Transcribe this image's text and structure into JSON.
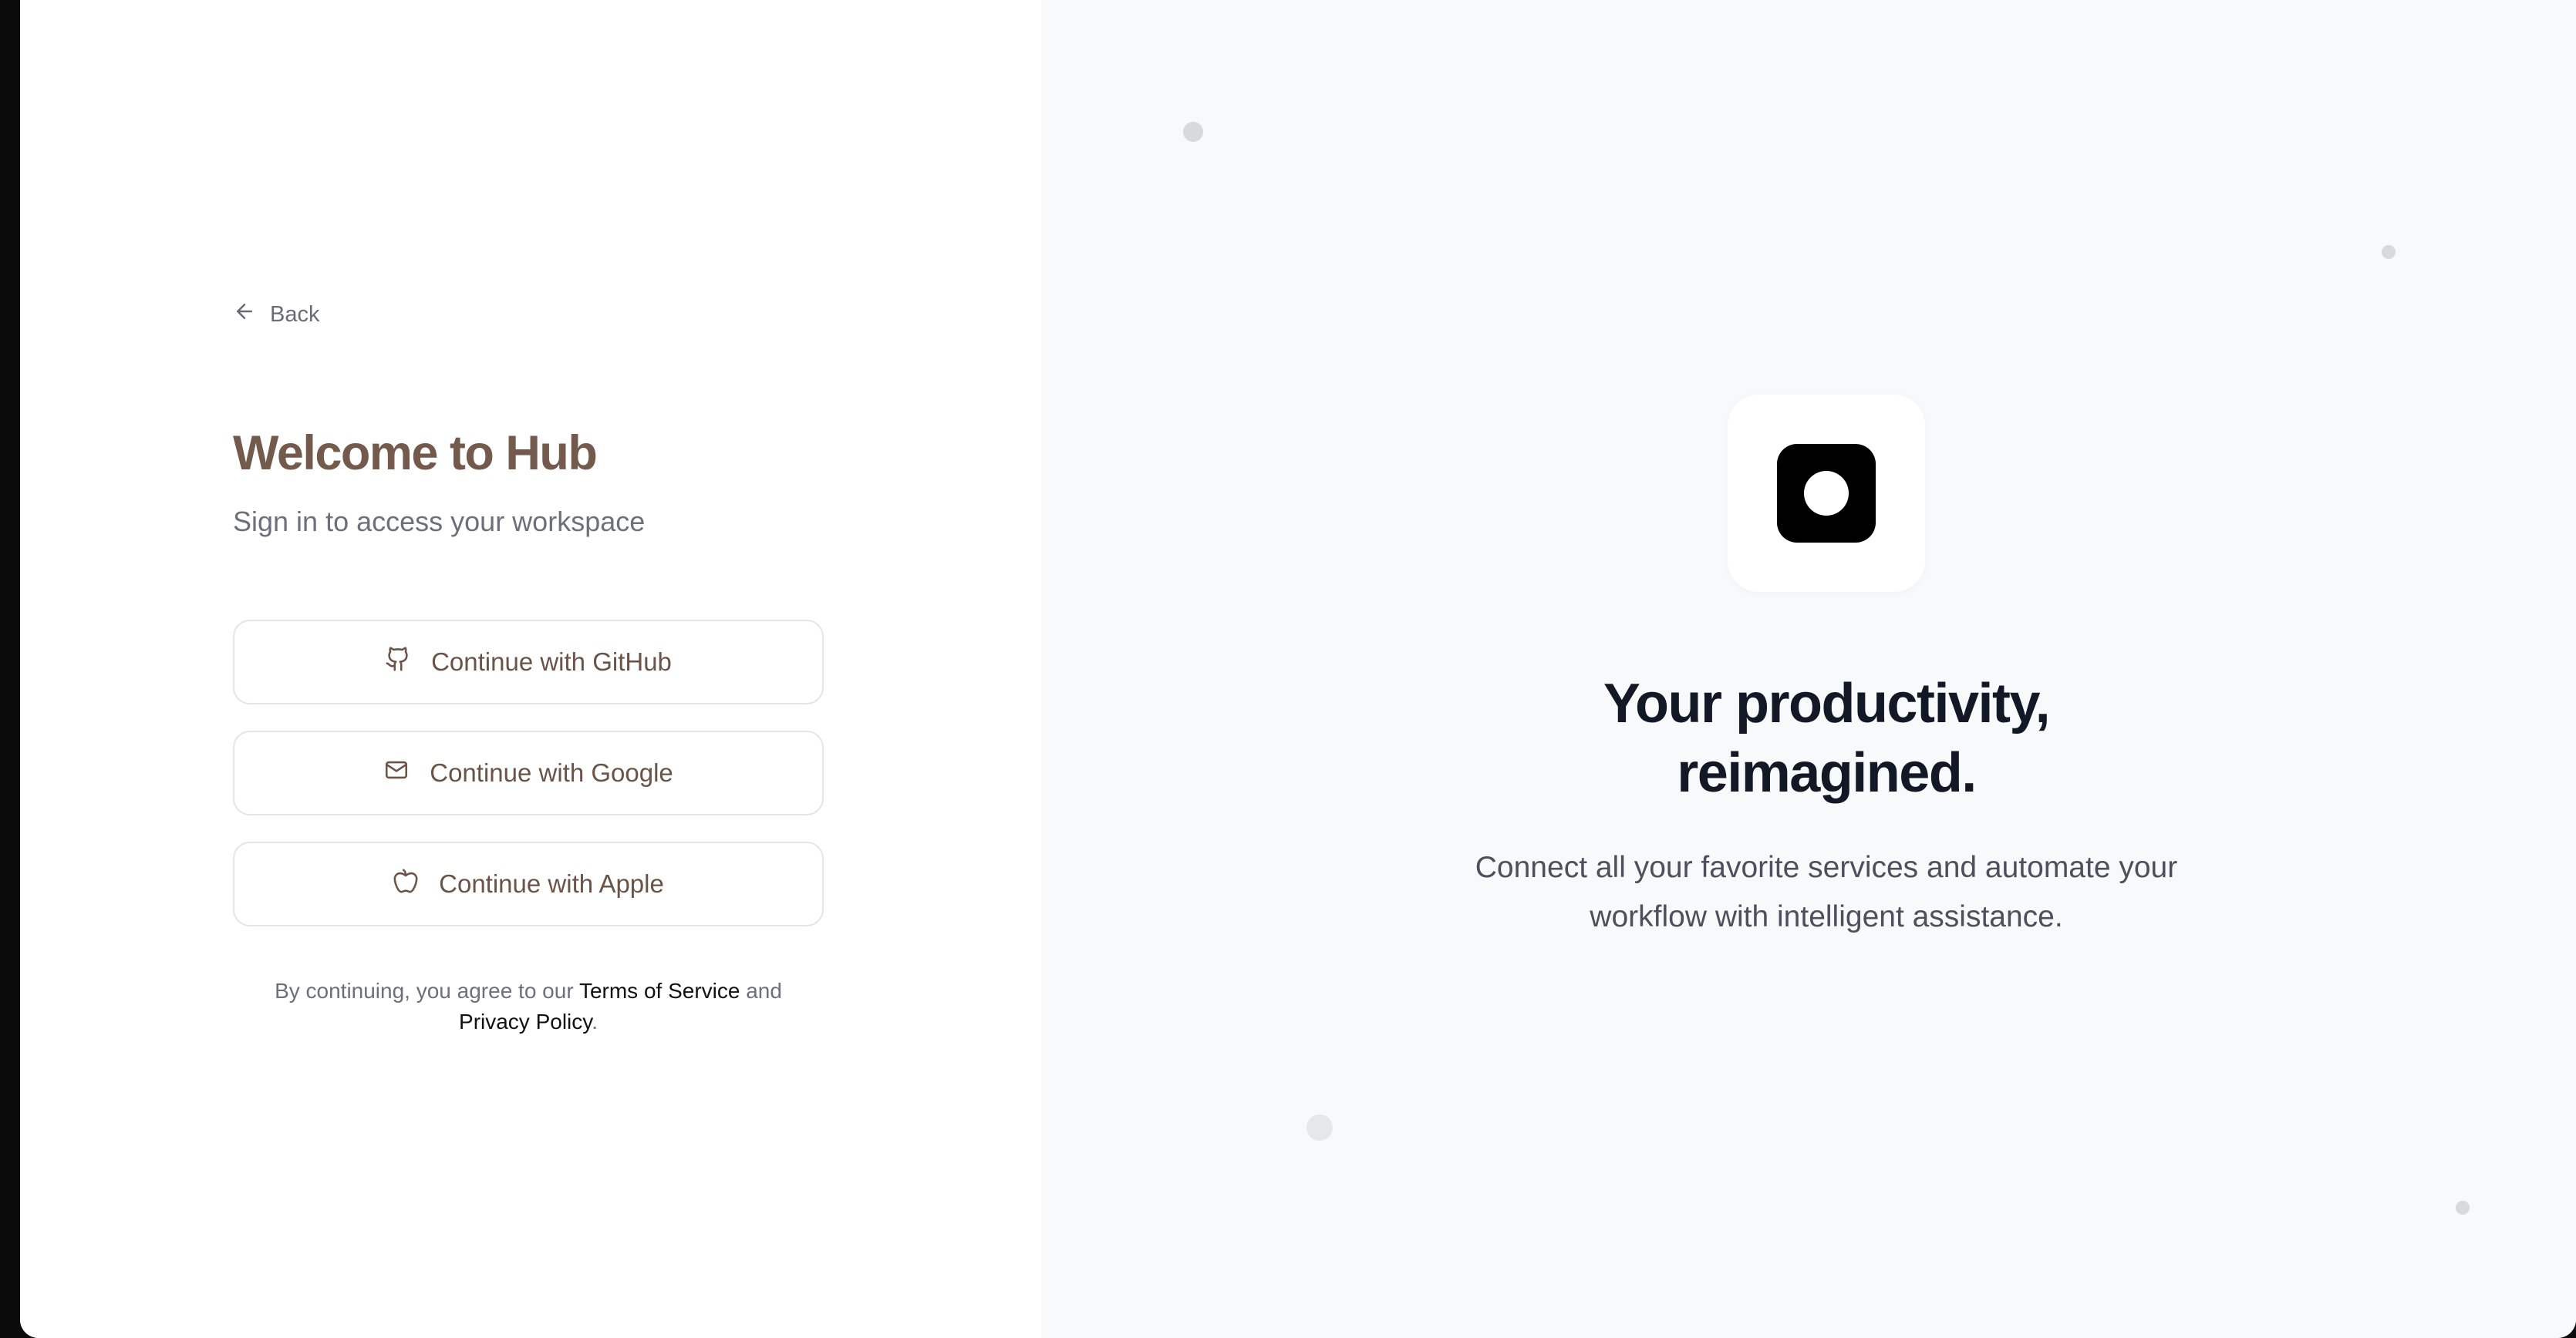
{
  "login": {
    "back_label": "Back",
    "title": "Welcome to Hub",
    "subtitle": "Sign in to access your workspace",
    "buttons": [
      {
        "label": "Continue with GitHub",
        "icon": "github-icon"
      },
      {
        "label": "Continue with Google",
        "icon": "mail-icon"
      },
      {
        "label": "Continue with Apple",
        "icon": "apple-icon"
      }
    ],
    "legal": {
      "prefix": "By continuing, you agree to our",
      "terms": "Terms of Service",
      "and": "and",
      "privacy": "Privacy Policy",
      "suffix": "."
    }
  },
  "promo": {
    "logo_icon": "app-logo-icon",
    "headline_line1": "Your productivity,",
    "headline_line2": "reimagined.",
    "tagline_line1": "Connect all your favorite services and automate your",
    "tagline_line2": "workflow with intelligent assistance."
  },
  "colors": {
    "accent_brown": "#735a4d",
    "right_bg": "#f8f9fb",
    "headline": "#121826",
    "logo": "#000000"
  }
}
